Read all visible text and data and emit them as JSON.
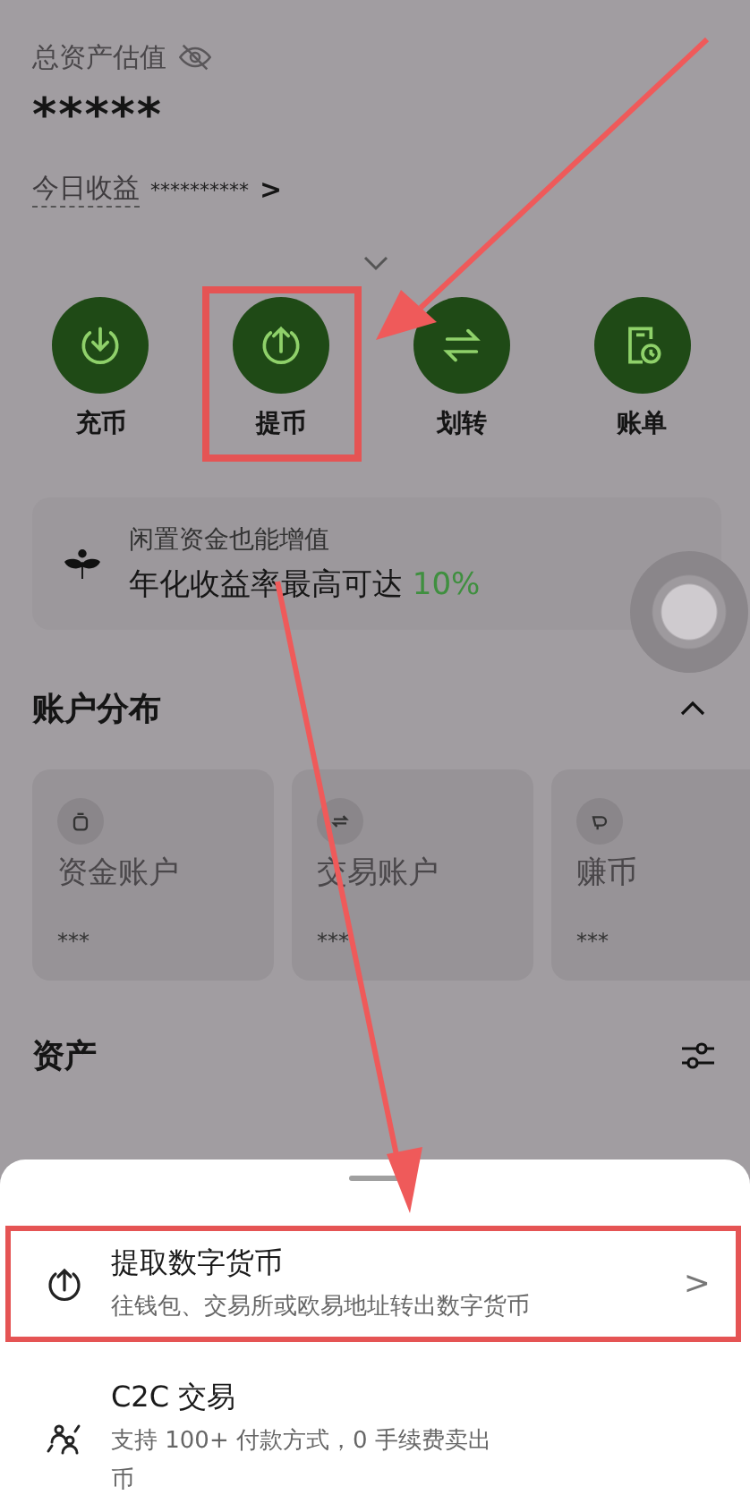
{
  "header": {
    "label": "总资产估值",
    "value": "*****",
    "today_label": "今日收益",
    "today_value": "**********",
    "chevron": ">"
  },
  "actions": [
    {
      "label": "充币",
      "kind": "deposit",
      "highlighted": false
    },
    {
      "label": "提币",
      "kind": "withdraw",
      "highlighted": true
    },
    {
      "label": "划转",
      "kind": "transfer",
      "highlighted": false
    },
    {
      "label": "账单",
      "kind": "bill",
      "highlighted": false
    }
  ],
  "promo": {
    "title": "闲置资金也能增值",
    "text": "年化收益率最高可达 ",
    "highlight": "10%"
  },
  "accounts": {
    "title": "账户分布",
    "expanded": true,
    "cards": [
      {
        "name": "资金账户",
        "value": "***",
        "kind": "funding"
      },
      {
        "name": "交易账户",
        "value": "***",
        "kind": "trading"
      },
      {
        "name": "赚币",
        "value": "***",
        "kind": "earn"
      }
    ]
  },
  "assets": {
    "title": "资产"
  },
  "sheet": {
    "items": [
      {
        "title": "提取数字货币",
        "description": [
          "往钱包、交易所或欧易地址转出数字货币"
        ],
        "kind": "withdraw",
        "highlighted": true,
        "chevron": ">"
      },
      {
        "title": "C2C 交易",
        "description": [
          "支持 100+ 付款方式，0 手续费卖出",
          "币"
        ],
        "kind": "c2c",
        "highlighted": false
      }
    ]
  }
}
